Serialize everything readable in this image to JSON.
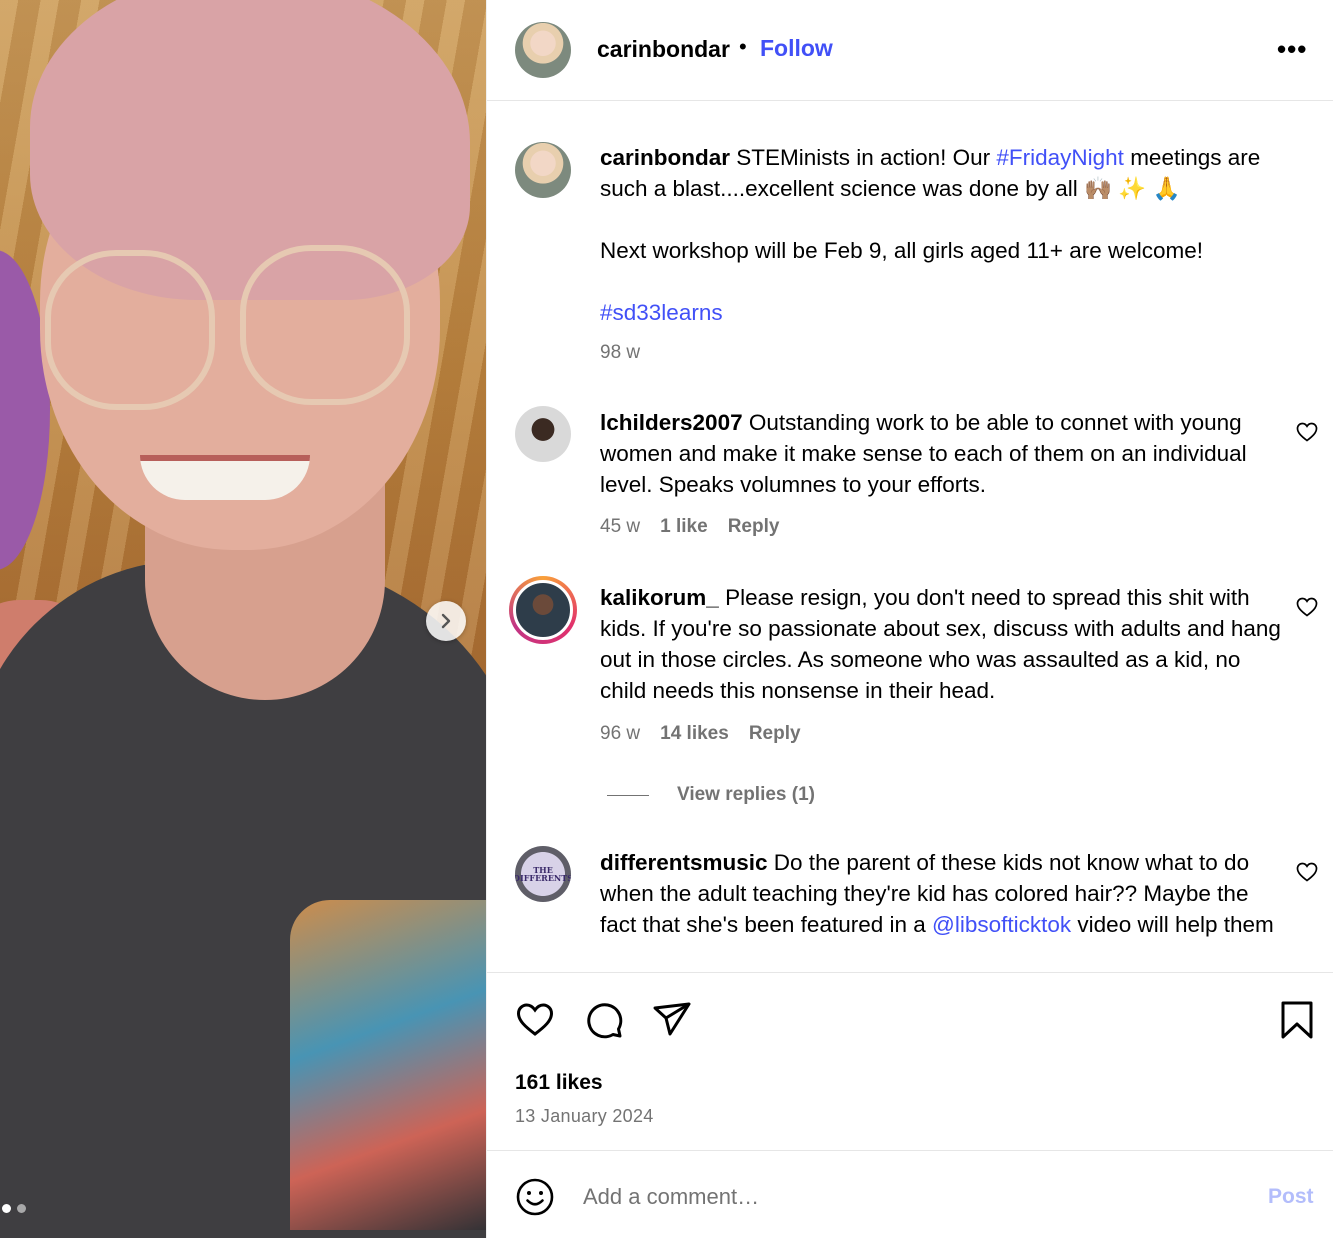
{
  "post": {
    "author": "carinbondar",
    "separator": "•",
    "follow_label": "Follow",
    "more_label": "•••",
    "image_count": 2,
    "active_image_index": 1
  },
  "caption": {
    "username": "carinbondar",
    "text_before_tag": " STEMinists in action! Our ",
    "tag1": "#FridayNight",
    "text_after_tag": " meetings are such a blast....excellent science was done by all 🙌🏽 ✨ 🙏",
    "line2": "Next workshop will be Feb 9, all girls aged 11+ are welcome!",
    "tag2": "#sd33learns",
    "time": "98 w"
  },
  "comments": [
    {
      "username": "lchilders2007",
      "text": " Outstanding work to be able to connet with young women and make it make sense to each of them on an individual level. Speaks volumnes to your efforts.",
      "time": "45 w",
      "likes": "1 like",
      "reply_label": "Reply"
    },
    {
      "username": "kalikorum_",
      "text": " Please resign, you don't need to spread this shit with kids. If you're so passionate about sex, discuss with adults and hang out in those circles. As someone who was assaulted as a kid, no child needs this nonsense in their head.",
      "time": "96 w",
      "likes": "14 likes",
      "reply_label": "Reply",
      "view_replies": "View replies (1)"
    },
    {
      "username": "differentsmusic",
      "text_before_mention": " Do the parent of these kids not know what to do when the adult teaching they're kid has colored hair?? Maybe the fact that she's been featured in a ",
      "mention": "@libsofticktok",
      "text_after_mention": " video will help them",
      "avatar_text": "THE DIFFERENTS"
    }
  ],
  "footer": {
    "likes": "161 likes",
    "date": "13 January 2024",
    "comment_placeholder": "Add a comment…",
    "post_label": "Post"
  },
  "colors": {
    "link": "#4150f7",
    "muted": "#737373",
    "post_disabled": "#b3bdfb"
  },
  "icons": [
    "more-icon",
    "heart-icon",
    "comment-icon",
    "share-icon",
    "bookmark-icon",
    "emoji-icon",
    "chevron-right-icon"
  ]
}
